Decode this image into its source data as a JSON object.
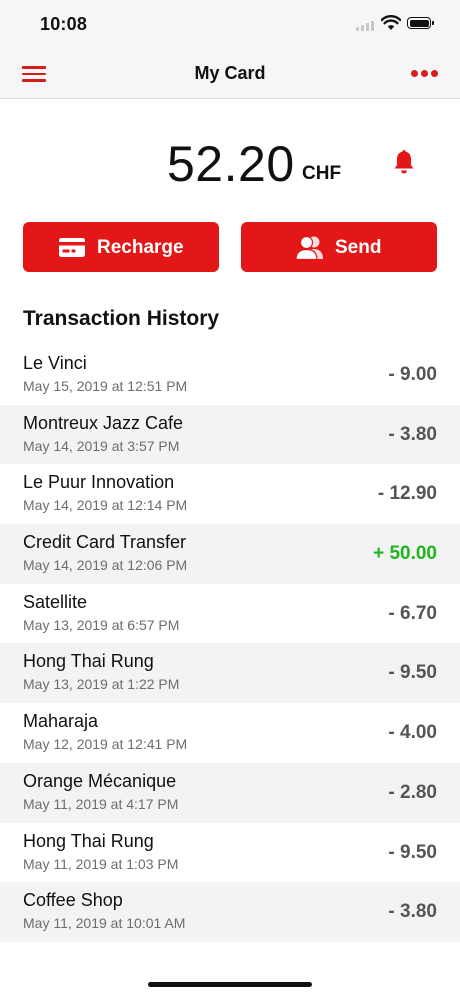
{
  "status_bar": {
    "time": "10:08"
  },
  "nav": {
    "title": "My Card",
    "menu_icon": "hamburger-icon",
    "more_icon": "ellipsis-icon"
  },
  "balance": {
    "amount": "52.20",
    "currency": "CHF",
    "bell_icon": "bell-icon"
  },
  "actions": {
    "recharge": {
      "label": "Recharge",
      "icon": "card-icon"
    },
    "send": {
      "label": "Send",
      "icon": "users-icon"
    }
  },
  "history": {
    "title": "Transaction History",
    "items": [
      {
        "name": "Le Vinci",
        "date": "May 15, 2019 at 12:51 PM",
        "amount": "- 9.00",
        "type": "debit"
      },
      {
        "name": "Montreux Jazz Cafe",
        "date": "May 14, 2019 at 3:57 PM",
        "amount": "- 3.80",
        "type": "debit"
      },
      {
        "name": "Le Puur Innovation",
        "date": "May 14, 2019 at 12:14 PM",
        "amount": "- 12.90",
        "type": "debit"
      },
      {
        "name": "Credit Card Transfer",
        "date": "May 14, 2019 at 12:06 PM",
        "amount": "+ 50.00",
        "type": "credit"
      },
      {
        "name": "Satellite",
        "date": "May 13, 2019 at 6:57 PM",
        "amount": "- 6.70",
        "type": "debit"
      },
      {
        "name": "Hong Thai Rung",
        "date": "May 13, 2019 at 1:22 PM",
        "amount": "- 9.50",
        "type": "debit"
      },
      {
        "name": "Maharaja",
        "date": "May 12, 2019 at 12:41 PM",
        "amount": "- 4.00",
        "type": "debit"
      },
      {
        "name": "Orange Mécanique",
        "date": "May 11, 2019 at 4:17 PM",
        "amount": "- 2.80",
        "type": "debit"
      },
      {
        "name": "Hong Thai Rung",
        "date": "May 11, 2019 at 1:03 PM",
        "amount": "- 9.50",
        "type": "debit"
      },
      {
        "name": "Coffee Shop",
        "date": "May 11, 2019 at 10:01 AM",
        "amount": "- 3.80",
        "type": "debit"
      }
    ]
  },
  "colors": {
    "accent": "#e31717",
    "credit": "#1fb51f",
    "debit": "#555555"
  }
}
